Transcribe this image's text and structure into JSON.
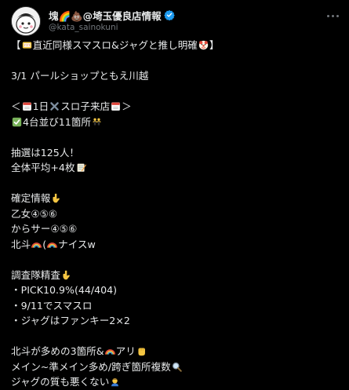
{
  "author": {
    "display_name": "塊🌈💩@埼玉優良店情報",
    "handle": "@kata_sainokuni",
    "verified": true,
    "avatar_icon": "avatar-character-icon"
  },
  "more_icon": "more-options-icon",
  "colors": {
    "background": "#000000",
    "text": "#e7e9ea",
    "secondary": "#71767b",
    "verified": "#1d9bf0"
  },
  "tweet_lines": {
    "l1a": "【",
    "l1b": "直近同様スマスロ&ジャグと推し明確",
    "l1c": "】",
    "l2": "3/1 パールショップともえ川越",
    "l3a": "＜",
    "l3b": "1日",
    "l3c": "スロ子来店",
    "l3d": "＞",
    "l4a": "4台並び11箇所",
    "l5": "抽選は125人！",
    "l6": "全体平均+4枚",
    "l7": "確定情報",
    "l8": "乙女④⑤⑥",
    "l9": "からサー④⑤⑥",
    "l10a": "北斗",
    "l10b": "(",
    "l10c": "ナイスw",
    "l11": "調査隊精査",
    "l12": "・PICK10.9%(44/404)",
    "l13": "・9/11でスマスロ",
    "l14": "・ジャグはファンキー2×2",
    "l15a": "北斗が多めの3箇所&",
    "l15b": "アリ",
    "l16": "メイン~準メイン多め/跨ぎ箇所複数",
    "l17": "ジャグの質も悪くない"
  }
}
